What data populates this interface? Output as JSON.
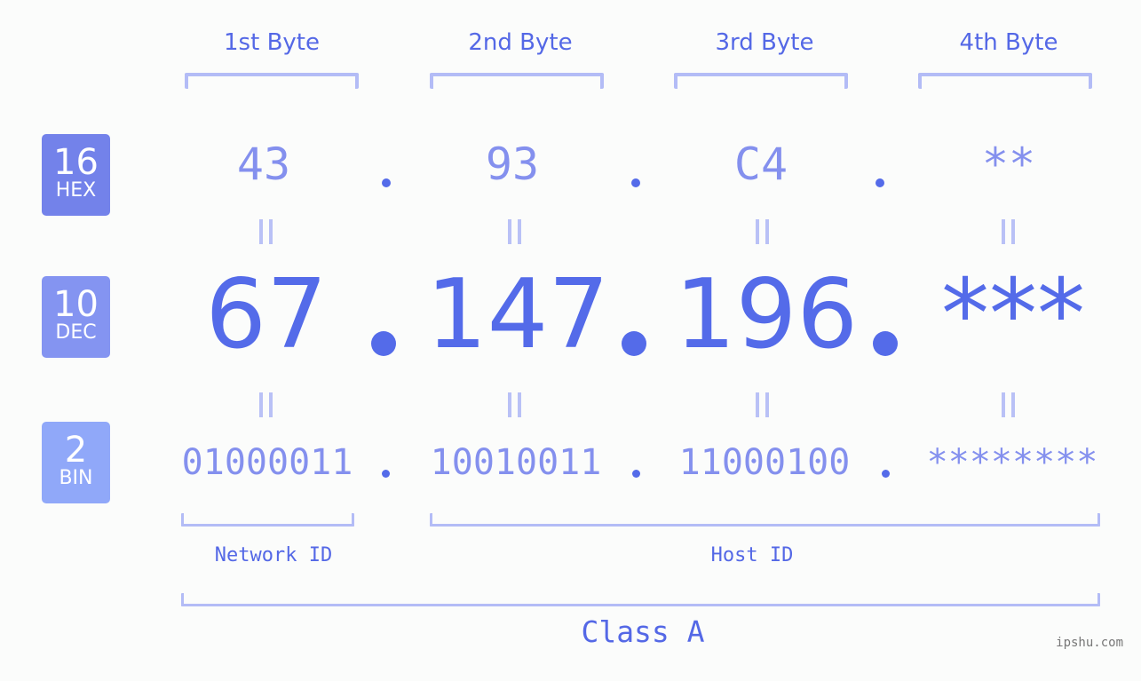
{
  "bytes": [
    {
      "label": "1st Byte",
      "hex": "43",
      "dec": "67",
      "bin": "01000011"
    },
    {
      "label": "2nd Byte",
      "hex": "93",
      "dec": "147",
      "bin": "10010011"
    },
    {
      "label": "3rd Byte",
      "hex": "C4",
      "dec": "196",
      "bin": "11000100"
    },
    {
      "label": "4th Byte",
      "hex": "**",
      "dec": "***",
      "bin": "********"
    }
  ],
  "bases": {
    "hex": {
      "num": "16",
      "unit": "HEX",
      "color": "#7382ea"
    },
    "dec": {
      "num": "10",
      "unit": "DEC",
      "color": "#8494f1"
    },
    "bin": {
      "num": "2",
      "unit": "BIN",
      "color": "#90a8f9"
    }
  },
  "labels": {
    "network_id": "Network ID",
    "host_id": "Host ID",
    "class": "Class A"
  },
  "watermark": "ipshu.com",
  "colors": {
    "accent": "#546be9",
    "muted": "#8490ee",
    "bracket": "#b3bcf6"
  }
}
